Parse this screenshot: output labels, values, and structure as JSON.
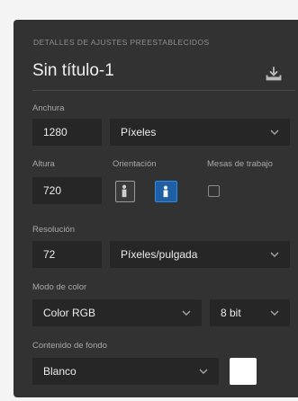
{
  "panel": {
    "header": "DETALLES DE AJUSTES PREESTABLECIDOS",
    "document_title": "Sin título-1"
  },
  "width": {
    "label": "Anchura",
    "value": "1280",
    "unit": "Píxeles"
  },
  "height": {
    "label": "Altura",
    "value": "720"
  },
  "orientation": {
    "label": "Orientación",
    "selected": "landscape"
  },
  "artboards": {
    "label": "Mesas de trabajo",
    "checked": false
  },
  "resolution": {
    "label": "Resolución",
    "value": "72",
    "unit": "Píxeles/pulgada"
  },
  "color_mode": {
    "label": "Modo de color",
    "value": "Color RGB",
    "bit_depth": "8 bit"
  },
  "background": {
    "label": "Contenido de fondo",
    "value": "Blanco",
    "swatch_color": "#ffffff"
  },
  "colors": {
    "panel_bg": "#323232",
    "field_bg": "#262626",
    "accent": "#2d8ceb"
  }
}
